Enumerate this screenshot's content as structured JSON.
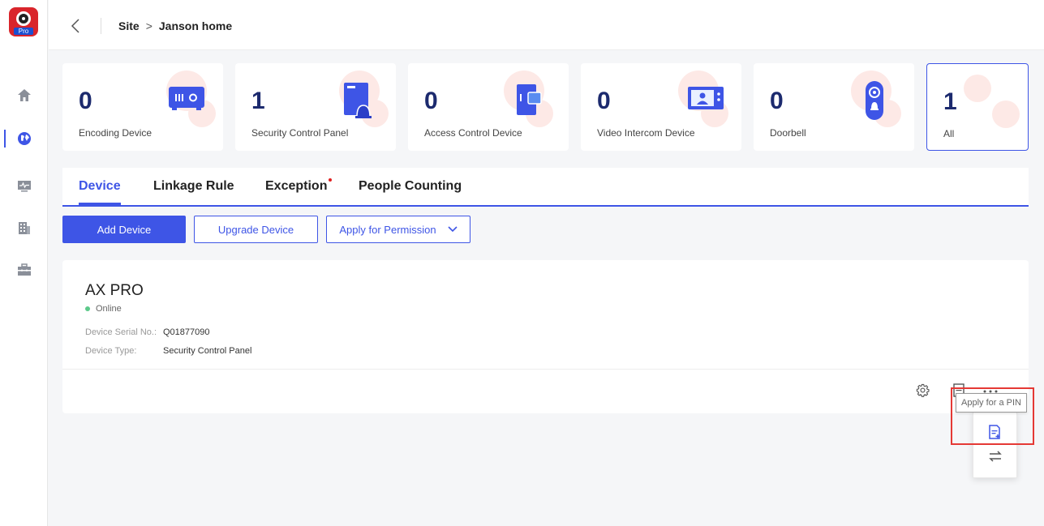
{
  "sidebar": {
    "logo_badge": "Pro",
    "items": [
      {
        "icon": "home-icon"
      },
      {
        "icon": "globe-icon",
        "active": true
      },
      {
        "icon": "monitor-icon"
      },
      {
        "icon": "building-icon"
      },
      {
        "icon": "toolbox-icon"
      }
    ]
  },
  "header": {
    "back_icon": "chevron-left-icon",
    "breadcrumb": [
      "Site",
      "Janson home"
    ],
    "breadcrumb_separator": ">"
  },
  "cards": [
    {
      "count": "0",
      "label": "Encoding Device",
      "icon": "nvr-icon"
    },
    {
      "count": "1",
      "label": "Security Control Panel",
      "icon": "control-panel-icon"
    },
    {
      "count": "0",
      "label": "Access Control Device",
      "icon": "access-control-icon"
    },
    {
      "count": "0",
      "label": "Video Intercom Device",
      "icon": "intercom-icon"
    },
    {
      "count": "0",
      "label": "Doorbell",
      "icon": "doorbell-icon"
    },
    {
      "count": "1",
      "label": "All",
      "selected": true
    }
  ],
  "tabs": [
    {
      "label": "Device",
      "active": true
    },
    {
      "label": "Linkage Rule"
    },
    {
      "label": "Exception",
      "badge_dot": true
    },
    {
      "label": "People Counting"
    }
  ],
  "actions": {
    "add_device": "Add Device",
    "upgrade_device": "Upgrade Device",
    "apply_permission": "Apply for Permission"
  },
  "device": {
    "name": "AX PRO",
    "status": "Online",
    "serial_label": "Device Serial No.:",
    "serial_value": "Q01877090",
    "type_label": "Device Type:",
    "type_value": "Security Control Panel"
  },
  "popup": {
    "tooltip": "Apply for a PIN",
    "items": [
      {
        "icon": "document-add-icon"
      },
      {
        "icon": "transfer-icon"
      }
    ]
  },
  "colors": {
    "accent": "#3e55e6",
    "online": "#5cc98a",
    "highlight": "#e53935",
    "logo": "#d9252b"
  }
}
